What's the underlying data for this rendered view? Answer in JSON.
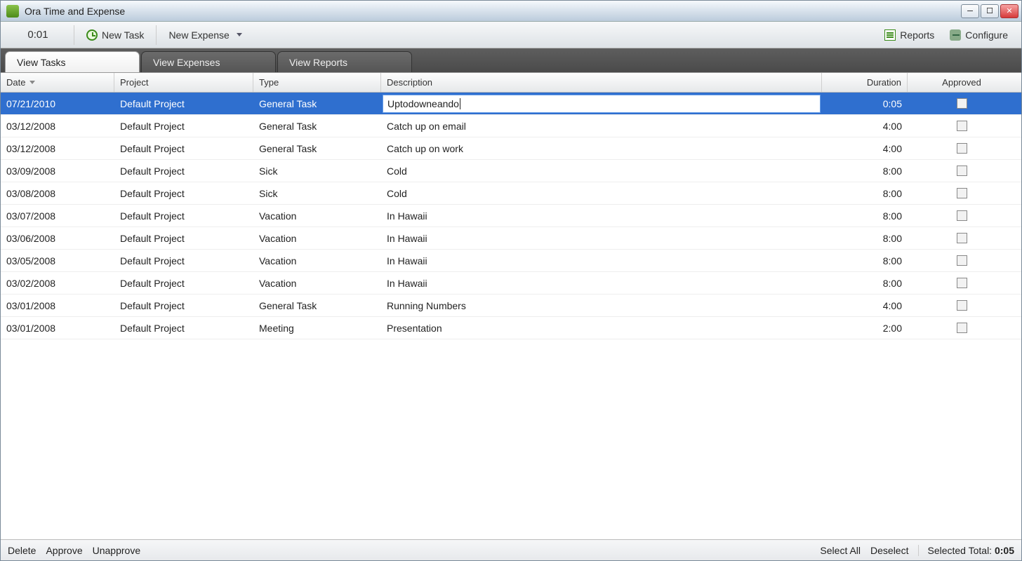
{
  "window": {
    "title": "Ora Time and Expense"
  },
  "toolbar": {
    "timer": "0:01",
    "new_task": "New Task",
    "new_expense": "New Expense",
    "reports": "Reports",
    "configure": "Configure"
  },
  "tabs": [
    {
      "label": "View Tasks",
      "active": true
    },
    {
      "label": "View Expenses",
      "active": false
    },
    {
      "label": "View Reports",
      "active": false
    }
  ],
  "columns": {
    "date": "Date",
    "project": "Project",
    "type": "Type",
    "description": "Description",
    "duration": "Duration",
    "approved": "Approved"
  },
  "rows": [
    {
      "date": "07/21/2010",
      "project": "Default Project",
      "type": "General Task",
      "description": "Uptodowneando",
      "duration": "0:05",
      "approved": false,
      "selected": true,
      "editing_description": true
    },
    {
      "date": "03/12/2008",
      "project": "Default Project",
      "type": "General Task",
      "description": "Catch up on email",
      "duration": "4:00",
      "approved": false
    },
    {
      "date": "03/12/2008",
      "project": "Default Project",
      "type": "General Task",
      "description": "Catch up on work",
      "duration": "4:00",
      "approved": false
    },
    {
      "date": "03/09/2008",
      "project": "Default Project",
      "type": "Sick",
      "description": "Cold",
      "duration": "8:00",
      "approved": false
    },
    {
      "date": "03/08/2008",
      "project": "Default Project",
      "type": "Sick",
      "description": "Cold",
      "duration": "8:00",
      "approved": false
    },
    {
      "date": "03/07/2008",
      "project": "Default Project",
      "type": "Vacation",
      "description": "In Hawaii",
      "duration": "8:00",
      "approved": false
    },
    {
      "date": "03/06/2008",
      "project": "Default Project",
      "type": "Vacation",
      "description": "In Hawaii",
      "duration": "8:00",
      "approved": false
    },
    {
      "date": "03/05/2008",
      "project": "Default Project",
      "type": "Vacation",
      "description": "In Hawaii",
      "duration": "8:00",
      "approved": false
    },
    {
      "date": "03/02/2008",
      "project": "Default Project",
      "type": "Vacation",
      "description": "In Hawaii",
      "duration": "8:00",
      "approved": false
    },
    {
      "date": "03/01/2008",
      "project": "Default Project",
      "type": "General Task",
      "description": "Running Numbers",
      "duration": "4:00",
      "approved": false
    },
    {
      "date": "03/01/2008",
      "project": "Default Project",
      "type": "Meeting",
      "description": "Presentation",
      "duration": "2:00",
      "approved": false
    }
  ],
  "statusbar": {
    "delete": "Delete",
    "approve": "Approve",
    "unapprove": "Unapprove",
    "select_all": "Select All",
    "deselect": "Deselect",
    "selected_total_label": "Selected Total:",
    "selected_total_value": "0:05"
  }
}
